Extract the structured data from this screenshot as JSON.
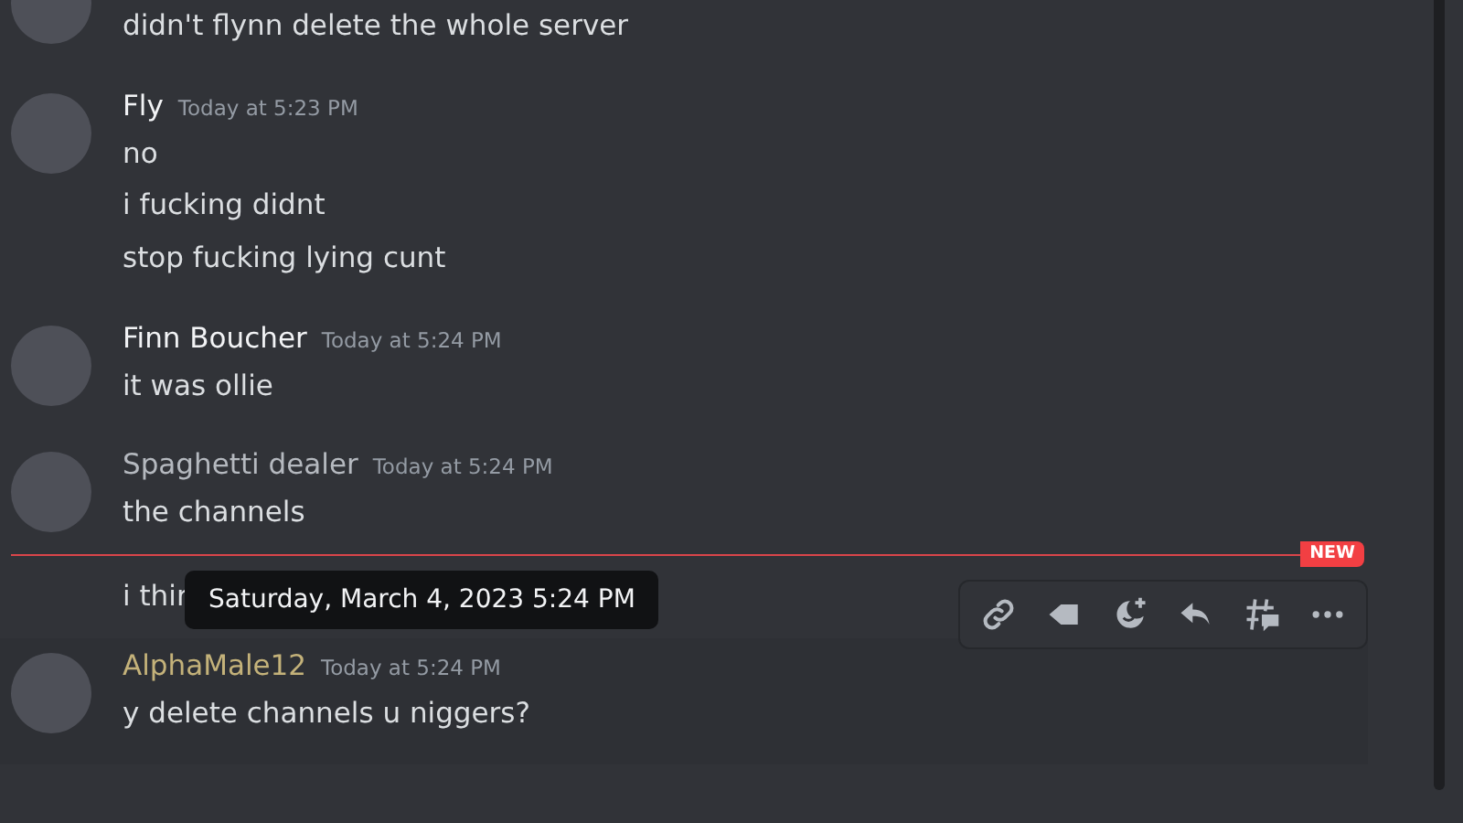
{
  "messages": [
    {
      "lines": [
        "didn't flynn delete the whole server"
      ]
    },
    {
      "author": "Fly",
      "color": "#f2f3f5",
      "time": "Today at 5:23 PM",
      "lines": [
        "no",
        "i fucking didnt",
        "stop fucking lying cunt"
      ]
    },
    {
      "author": "Finn Boucher",
      "color": "#f2f3f5",
      "time": "Today at 5:24 PM",
      "lines": [
        "it was ollie"
      ]
    },
    {
      "author": "Spaghetti dealer",
      "color": "#b5b9bf",
      "time": "Today at 5:24 PM",
      "lines": [
        "the channels"
      ],
      "new_divider": "NEW",
      "after_lines": [
        "i thir"
      ]
    },
    {
      "author": "AlphaMale12",
      "color": "#c4b27a",
      "time": "Today at 5:24 PM",
      "lines": [
        "y delete channels u niggers?"
      ],
      "hovered": true
    }
  ],
  "tooltip": {
    "text": "Saturday, March 4, 2023 5:24 PM"
  },
  "toolbar": {
    "buttons": [
      {
        "kind": "link"
      },
      {
        "kind": "tag"
      },
      {
        "kind": "react"
      },
      {
        "kind": "reply"
      },
      {
        "kind": "thread"
      },
      {
        "kind": "more"
      }
    ]
  }
}
